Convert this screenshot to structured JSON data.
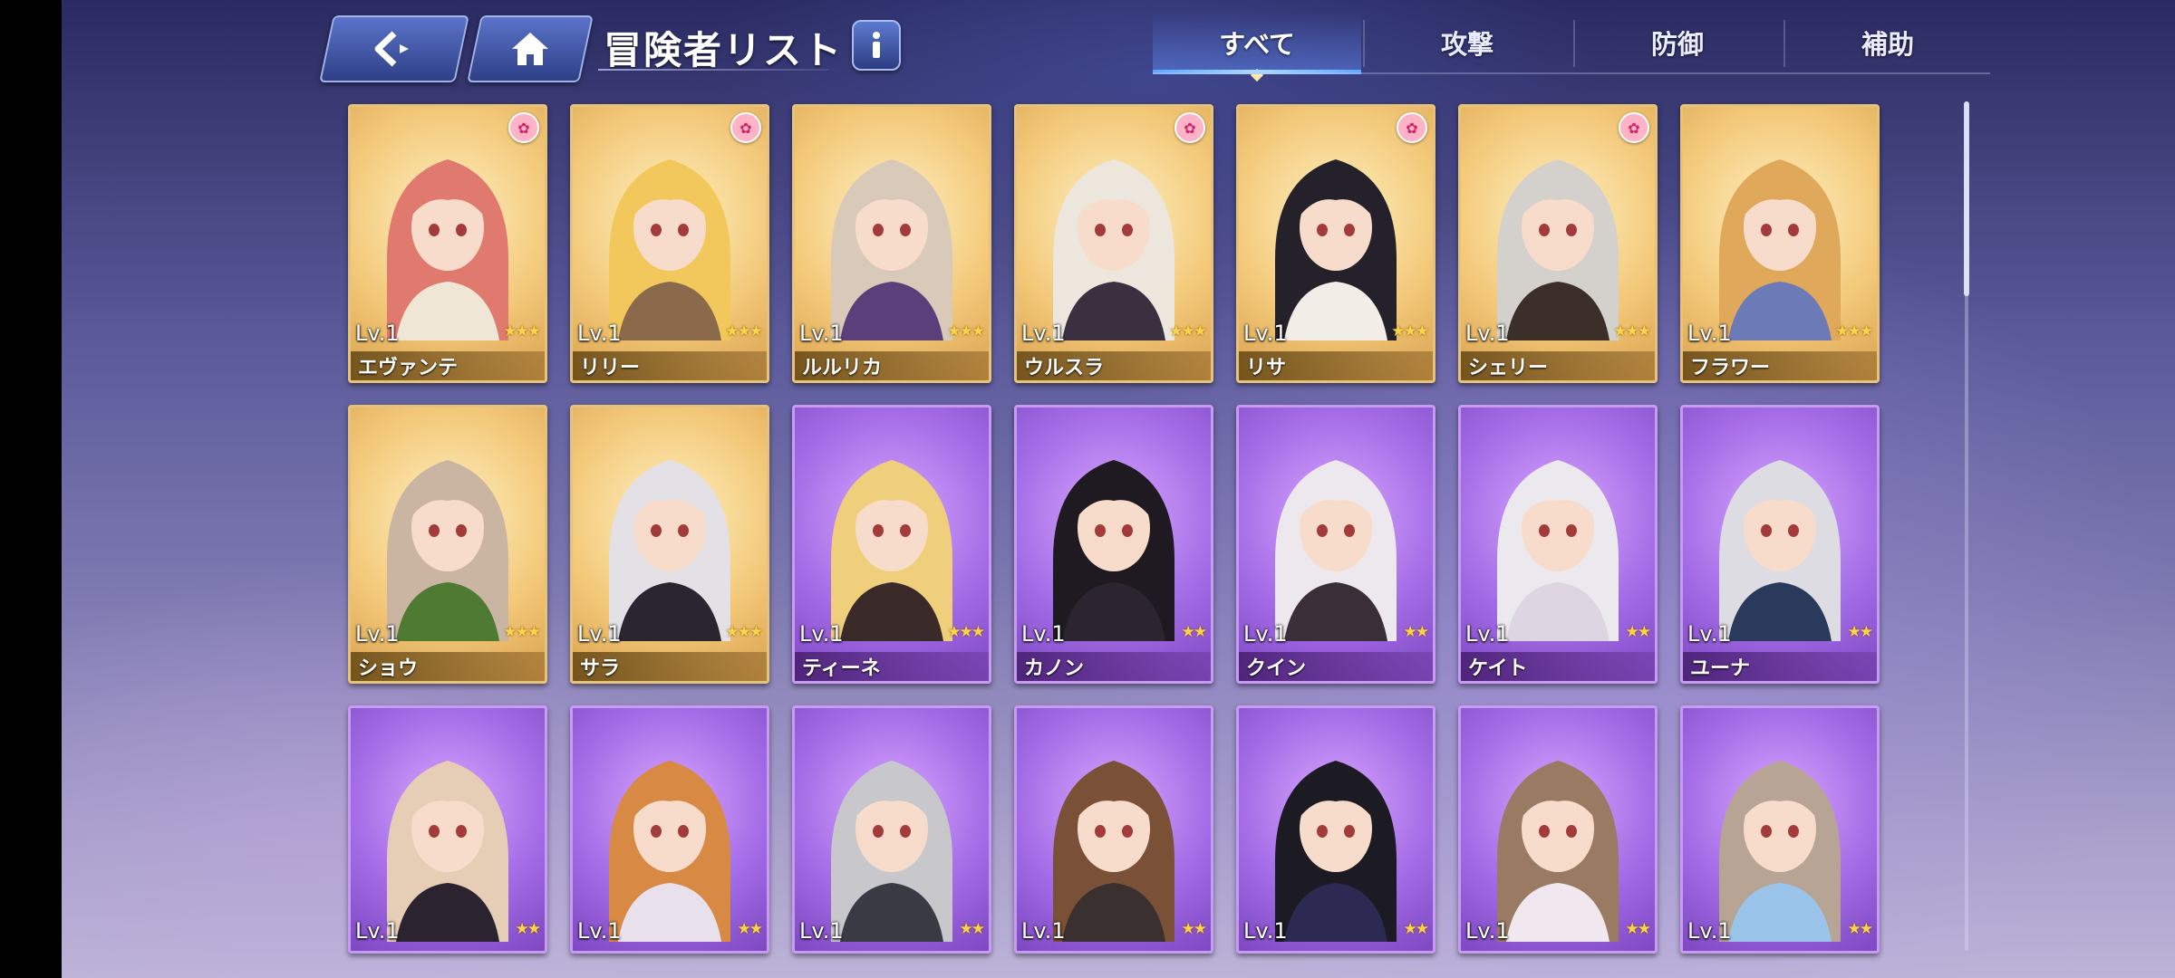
{
  "header": {
    "title": "冒険者リスト",
    "back_icon": "back-arrow-icon",
    "home_icon": "home-icon",
    "info_icon": "info-icon"
  },
  "tabs": [
    {
      "label": "すべて",
      "active": true
    },
    {
      "label": "攻撃",
      "active": false
    },
    {
      "label": "防御",
      "active": false
    },
    {
      "label": "補助",
      "active": false
    }
  ],
  "adventurers": [
    {
      "name": "エヴァンテ",
      "level": "Lv.1",
      "stars": 3,
      "rarity": "gold",
      "badge": true,
      "hair": "#e07a6e",
      "outfit": "#efe6d6"
    },
    {
      "name": "リリー",
      "level": "Lv.1",
      "stars": 3,
      "rarity": "gold",
      "badge": true,
      "hair": "#f2c85c",
      "outfit": "#8a6a4a"
    },
    {
      "name": "ルルリカ",
      "level": "Lv.1",
      "stars": 3,
      "rarity": "gold",
      "badge": false,
      "hair": "#d9c9b9",
      "outfit": "#5b3f7a"
    },
    {
      "name": "ウルスラ",
      "level": "Lv.1",
      "stars": 3,
      "rarity": "gold",
      "badge": true,
      "hair": "#ece6dc",
      "outfit": "#3a3040"
    },
    {
      "name": "リサ",
      "level": "Lv.1",
      "stars": 3,
      "rarity": "gold",
      "badge": true,
      "hair": "#25212a",
      "outfit": "#f2ede6"
    },
    {
      "name": "シェリー",
      "level": "Lv.1",
      "stars": 3,
      "rarity": "gold",
      "badge": true,
      "hair": "#d4d0cc",
      "outfit": "#3c2f2a"
    },
    {
      "name": "フラワー",
      "level": "Lv.1",
      "stars": 3,
      "rarity": "gold",
      "badge": false,
      "hair": "#e0a85a",
      "outfit": "#6c7ab8"
    },
    {
      "name": "ショウ",
      "level": "Lv.1",
      "stars": 3,
      "rarity": "gold",
      "badge": false,
      "hair": "#c9b5a2",
      "outfit": "#4f7a32"
    },
    {
      "name": "サラ",
      "level": "Lv.1",
      "stars": 3,
      "rarity": "gold",
      "badge": false,
      "hair": "#e3e0e6",
      "outfit": "#2a2530"
    },
    {
      "name": "ティーネ",
      "level": "Lv.1",
      "stars": 3,
      "rarity": "purple",
      "badge": false,
      "hair": "#f0cf7c",
      "outfit": "#3a2a2a"
    },
    {
      "name": "カノン",
      "level": "Lv.1",
      "stars": 2,
      "rarity": "purple",
      "badge": false,
      "hair": "#1f1a22",
      "outfit": "#2c2430"
    },
    {
      "name": "クイン",
      "level": "Lv.1",
      "stars": 2,
      "rarity": "purple",
      "badge": false,
      "hair": "#ece8ee",
      "outfit": "#3a2f38"
    },
    {
      "name": "ケイト",
      "level": "Lv.1",
      "stars": 2,
      "rarity": "purple",
      "badge": false,
      "hair": "#ebe9ee",
      "outfit": "#ddd6e2"
    },
    {
      "name": "ユーナ",
      "level": "Lv.1",
      "stars": 2,
      "rarity": "purple",
      "badge": false,
      "hair": "#dcdce2",
      "outfit": "#2a3a5c"
    },
    {
      "name": "",
      "level": "Lv.1",
      "stars": 2,
      "rarity": "purple",
      "badge": false,
      "hair": "#e6cdb5",
      "outfit": "#2b2330"
    },
    {
      "name": "",
      "level": "Lv.1",
      "stars": 2,
      "rarity": "purple",
      "badge": false,
      "hair": "#d88a45",
      "outfit": "#e8e0ea"
    },
    {
      "name": "",
      "level": "Lv.1",
      "stars": 2,
      "rarity": "purple",
      "badge": false,
      "hair": "#c8c8cc",
      "outfit": "#3a3a44"
    },
    {
      "name": "",
      "level": "Lv.1",
      "stars": 2,
      "rarity": "purple",
      "badge": false,
      "hair": "#7a5036",
      "outfit": "#3a3030"
    },
    {
      "name": "",
      "level": "Lv.1",
      "stars": 2,
      "rarity": "purple",
      "badge": false,
      "hair": "#1c1a22",
      "outfit": "#2c2a52"
    },
    {
      "name": "",
      "level": "Lv.1",
      "stars": 2,
      "rarity": "purple",
      "badge": false,
      "hair": "#9a7a62",
      "outfit": "#f0e8ee"
    },
    {
      "name": "",
      "level": "Lv.1",
      "stars": 2,
      "rarity": "purple",
      "badge": false,
      "hair": "#b7a494",
      "outfit": "#9bc4ea"
    }
  ],
  "colors": {
    "gold_card": "#f3c97a",
    "purple_card": "#a46be6",
    "tab_accent": "#5fa8ff",
    "star": "#ffd24a"
  }
}
